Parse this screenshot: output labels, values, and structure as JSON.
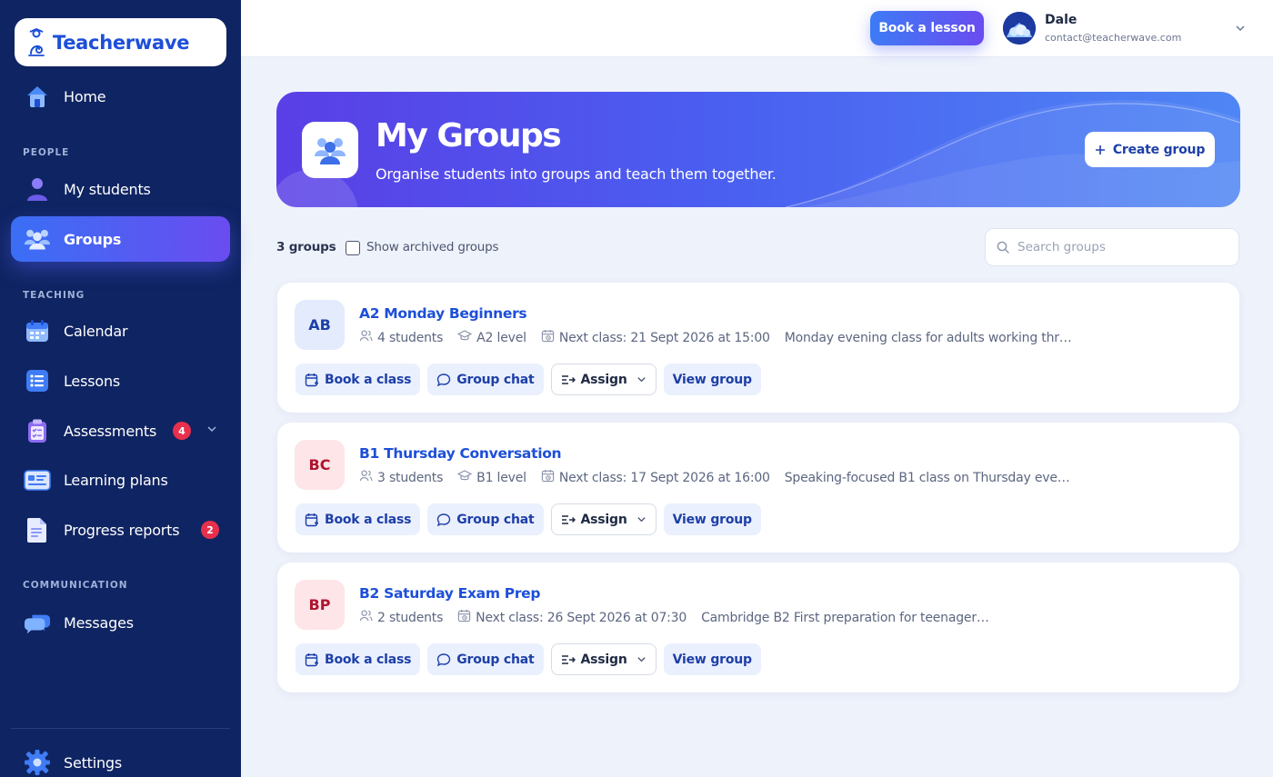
{
  "app": {
    "name": "Teacherwave"
  },
  "sidebar": {
    "home_label": "Home",
    "sections": {
      "people": "PEOPLE",
      "teaching": "TEACHING",
      "communication": "COMMUNICATION"
    },
    "items": [
      {
        "label": "My students",
        "icon": "student-icon"
      },
      {
        "label": "Groups",
        "icon": "groups-icon",
        "active": true
      },
      {
        "label": "Calendar",
        "icon": "calendar-icon"
      },
      {
        "label": "Lessons",
        "icon": "list-icon"
      },
      {
        "label": "Assessments",
        "icon": "clipboard-icon",
        "badge": "4"
      },
      {
        "label": "Learning plans",
        "icon": "plan-icon"
      },
      {
        "label": "Progress reports",
        "icon": "document-icon",
        "badge": "2"
      },
      {
        "label": "Messages",
        "icon": "chat-bubbles-icon"
      }
    ],
    "settings_label": "Settings"
  },
  "header": {
    "book_lesson_label": "Book a lesson",
    "user": {
      "name": "Dale",
      "email": "contact@teacherwave.com"
    }
  },
  "hero": {
    "title": "My Groups",
    "subtitle": "Organise students into groups and teach them together.",
    "create_label": "Create group"
  },
  "toolbar": {
    "count_label": "3 groups",
    "archived_label": "Show archived groups",
    "archived_checked": false,
    "search_placeholder": "Search groups"
  },
  "groups": [
    {
      "initials": "AB",
      "name": "A2 Monday Beginners",
      "students": "4 students",
      "level": "A2 level",
      "next_class": "Next class: 21 Sept 2026 at 15:00",
      "description": "Monday evening class for adults working thr…",
      "avatar_bg": "#e3ebfd",
      "avatar_fg": "#1d3fa8"
    },
    {
      "initials": "BC",
      "name": "B1 Thursday Conversation",
      "students": "3 students",
      "level": "B1 level",
      "next_class": "Next class: 17 Sept 2026 at 16:00",
      "description": "Speaking-focused B1 class on Thursday eve…",
      "avatar_bg": "#fde5e8",
      "avatar_fg": "#b0142e"
    },
    {
      "initials": "BP",
      "name": "B2 Saturday Exam Prep",
      "students": "2 students",
      "next_class": "Next class: 26 Sept 2026 at 07:30",
      "description": "Cambridge B2 First preparation for teenager…",
      "avatar_bg": "#fde5e8",
      "avatar_fg": "#b0142e"
    }
  ],
  "card_actions": {
    "book_class": "Book a class",
    "group_chat": "Group chat",
    "assign": "Assign",
    "view_group": "View group"
  },
  "colors": {
    "sidebar_bg": "#0f2462",
    "accent": "#1d4fd8",
    "page_bg": "#eef2fb",
    "badge": "#e8304c"
  }
}
